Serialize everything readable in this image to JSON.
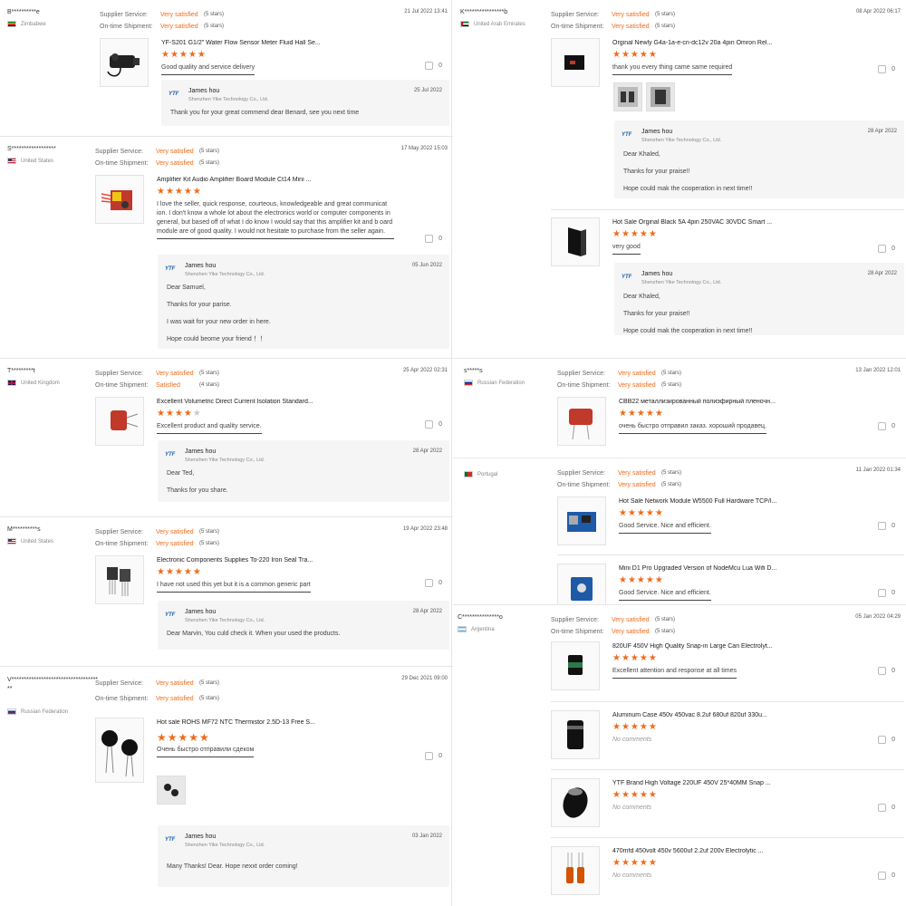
{
  "common": {
    "supplier_label": "Supplier Service:",
    "shipment_label": "On-time Shipment:",
    "very_satisfied": "Very satisfied",
    "satisfied": "Satisfied",
    "five_stars": "(5 stars)",
    "four_stars": "(4 stars)",
    "like_count": "0",
    "seller_name": "James hou",
    "seller_company": "Shenzhen Yike Technology Co., Ltd.",
    "seller_logo": "YTF",
    "no_comments": "No comments"
  },
  "colors": {
    "accent": "#f06b1c",
    "reply_bg": "#f5f5f5",
    "star_off": "#c8c8c8"
  },
  "left": [
    {
      "user": "B**********e",
      "country": "Zimbabwe",
      "supplier": "Very satisfied",
      "shipment": "Very satisfied",
      "date": "21 Jul 2022 13:41",
      "product": "YF-S201 G1/2\" Water Flow Sensor Meter Fluid Hall Se...",
      "rating": 5,
      "text": "Good quality and service delivery",
      "reply_date": "25 Jul 2022",
      "reply": [
        "Thank you for your great commend dear Benard, see you next time"
      ]
    },
    {
      "user": "S******************",
      "country": "United States",
      "supplier": "Very satisfied",
      "shipment": "Very satisfied",
      "date": "17 May 2022 15:03",
      "product": "Amplifier Kit Audio Amplifier Board Module Ct14 Mini ...",
      "rating": 5,
      "text": "I love the seller, quick response, courteous, knowledgeable and great communicat ion. I don't know a whole lot about the electronics world or computer components in general, but based off of what I do know I would say that this amplifier kit and b oard module are of good quality. I would not hesitate to purchase from the seller again.",
      "reply_date": "05 Jun 2022",
      "reply": [
        "Dear Samuel,",
        "Thanks for your parise.",
        "I was wait for your new order in here.",
        "Hope could beome your friend ！！"
      ]
    },
    {
      "user": "T*********t",
      "country": "United Kingdom",
      "supplier": "Very satisfied",
      "shipment": "Satisfied",
      "date": "25 Apr 2022 02:31",
      "product": "Excellent Volumetric Direct Current Isolation Standard...",
      "rating": 4,
      "text": "Excellent product and quality service.",
      "reply_date": "28 Apr 2022",
      "reply": [
        "Dear Ted,",
        "Thanks for you share."
      ]
    },
    {
      "user": "M**********s",
      "country": "United States",
      "supplier": "Very satisfied",
      "shipment": "Very satisfied",
      "date": "19 Apr 2022 23:48",
      "product": "Electronic Components Supplies To-220 Iron Seal Tra...",
      "rating": 5,
      "text": "I have not used this yet but it is a common generic part",
      "reply_date": "28 Apr 2022",
      "reply": [
        "Dear Marvin,  You culd check it. When your used the products."
      ]
    },
    {
      "user": "V***********************************",
      "user2": "**",
      "country": "Russian Federation",
      "supplier": "Very satisfied",
      "shipment": "Very satisfied",
      "date": "29 Dec 2021 09:00",
      "product": "Hot sale ROHS MF72 NTC Thermistor 2.5D-13 Free S...",
      "rating": 5,
      "text": "Очень быстро отправили сдеком",
      "reply_date": "03 Jan 2022",
      "reply": [
        "Many Thanks! Dear. Hope nexxt order coming!"
      ]
    }
  ],
  "right": [
    {
      "user": "K****************b",
      "country": "United Arab Emirates",
      "supplier": "Very satisfied",
      "shipment": "Very satisfied",
      "date": "08 Apr 2022 06:17",
      "products": [
        {
          "title": "Orginal Newly G4a-1a-e-cn-dc12v 20a 4pin Omron Rel...",
          "rating": 5,
          "text": "thank you every thing came same required",
          "reply_date": "28 Apr 2022",
          "reply": [
            "Dear Khaled,",
            "Thanks for your praise!!",
            "Hope could mak the cooperation in next time!!"
          ]
        },
        {
          "title": "Hot Sale Orginal Black 5A 4pin 250VAC 30VDC Smart ...",
          "rating": 5,
          "text": "very good",
          "reply_date": "28 Apr 2022",
          "reply": [
            "Dear Khaled,",
            "Thanks for your praise!!",
            "Hope could mak the cooperation in next time!!"
          ]
        }
      ]
    },
    {
      "user": "s*****s",
      "country": "Russian Federation",
      "supplier": "Very satisfied",
      "shipment": "Very satisfied",
      "date": "13 Jan 2022 12:01",
      "products": [
        {
          "title": "CBB22 металлизированный полиэфирный пленочн...",
          "rating": 5,
          "text": "очень быстро отправил заказ. хороший продавец."
        }
      ]
    },
    {
      "user": "",
      "country": "Portugal",
      "supplier": "Very satisfied",
      "shipment": "Very satisfied",
      "date": "11 Jan 2022 01:34",
      "products": [
        {
          "title": "Hot Sale Network Module W5500 Full Hardware TCP/I...",
          "rating": 5,
          "text": "Good Service. Nice and efficient."
        },
        {
          "title": "Mini D1 Pro Upgraded Version of NodeMcu Lua Wifi D...",
          "rating": 5,
          "text": "Good Service. Nice and efficient."
        }
      ]
    },
    {
      "user": "C***************o",
      "country": "Argentina",
      "supplier": "Very satisfied",
      "shipment": "Very satisfied",
      "date": "05 Jan 2022 04:29",
      "products": [
        {
          "title": "820UF 450V High Quality Snap-in Large Can Electrolyt...",
          "rating": 5,
          "text": "Excellent attention and response at all times"
        },
        {
          "title": "Aluminum Case 450v 450vac 8.2uf 680uf 820uf 330u...",
          "rating": 5,
          "text": ""
        },
        {
          "title": "YTF Brand High Voltage 220UF 450V 25*40MM Snap ...",
          "rating": 5,
          "text": ""
        },
        {
          "title": "470mfd 450volt 450v 5600uf 2.2uf 200v Electrolytic ...",
          "rating": 5,
          "text": ""
        }
      ]
    }
  ]
}
